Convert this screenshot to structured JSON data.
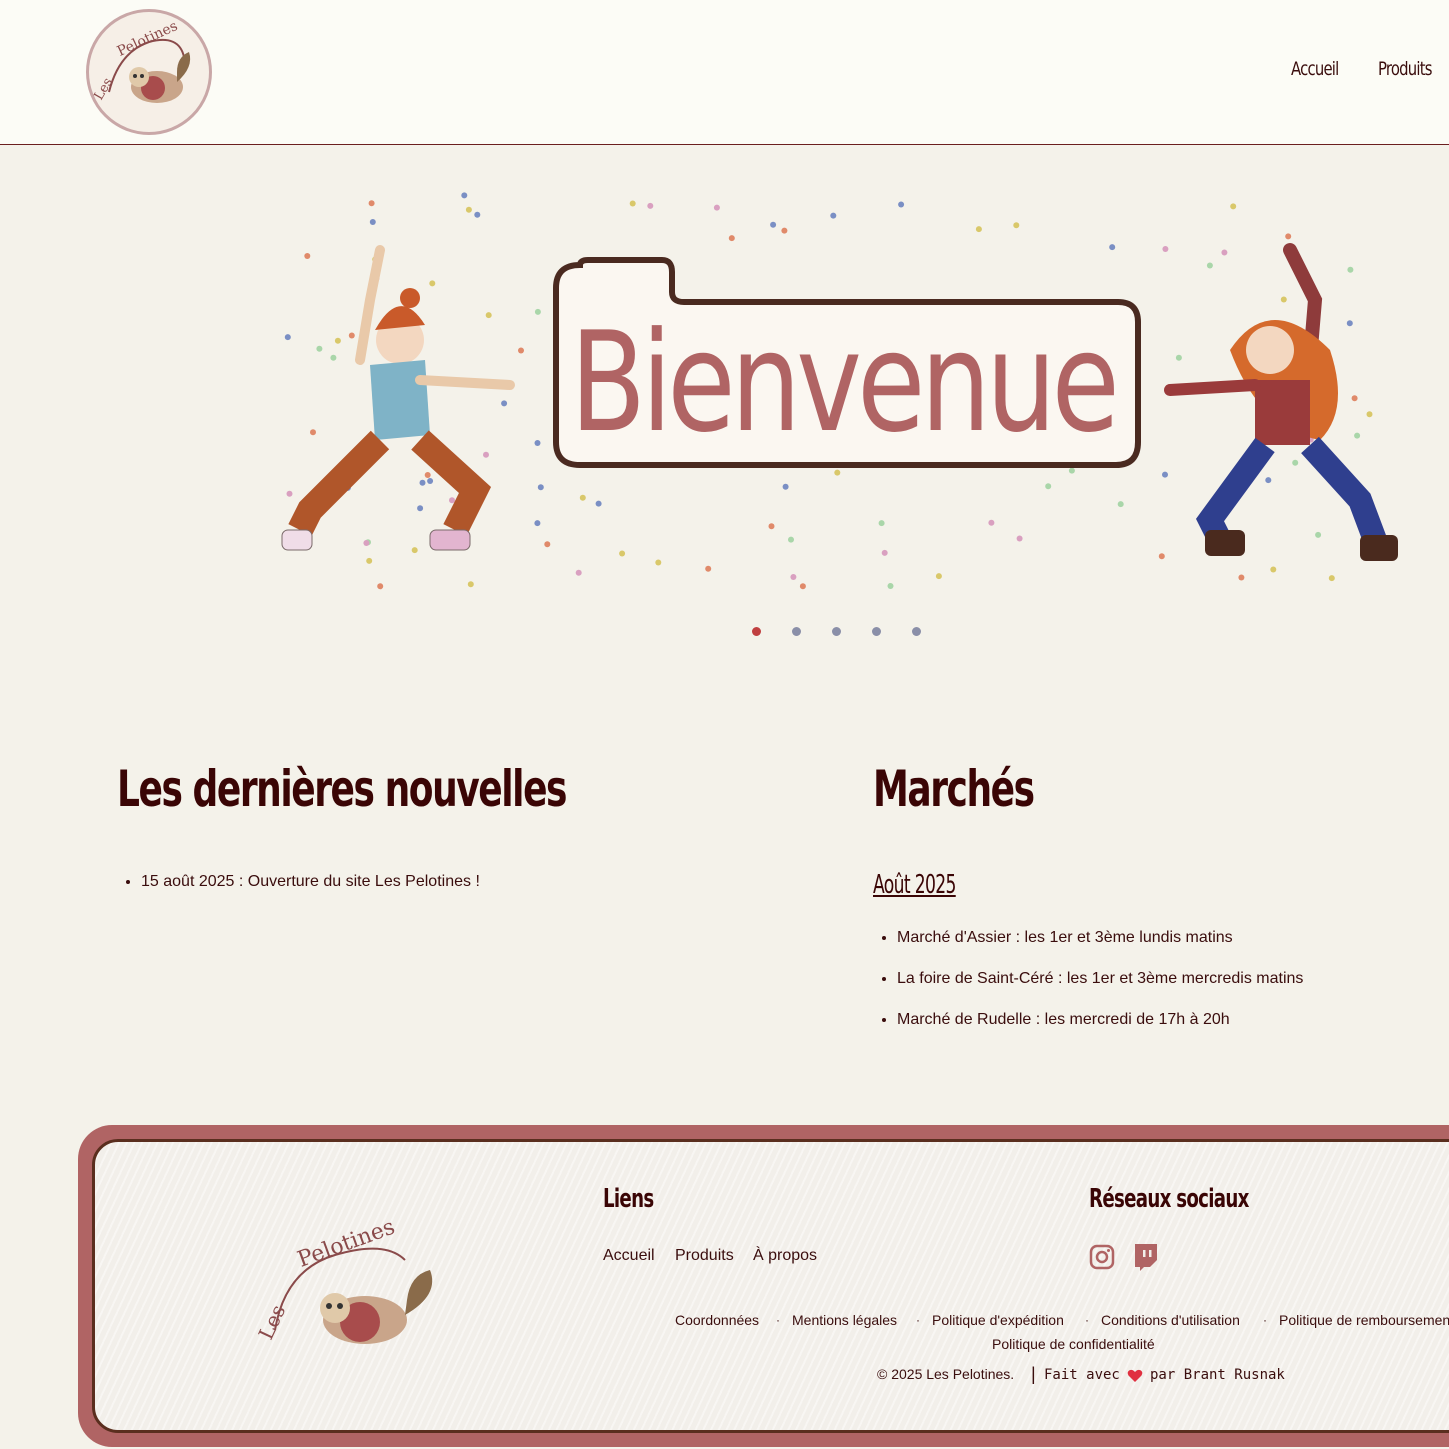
{
  "header": {
    "logo_alt": "Les Pelotines",
    "nav": [
      {
        "label": "Accueil"
      },
      {
        "label": "Produits"
      }
    ]
  },
  "hero": {
    "banner_text": "Bienvenue",
    "carousel_count": 5,
    "carousel_active": 1
  },
  "news": {
    "title": "Les dernières nouvelles",
    "items": [
      "15 août 2025 : Ouverture du site Les Pelotines !"
    ]
  },
  "markets": {
    "title": "Marchés",
    "month": "Août 2025",
    "items": [
      "Marché d'Assier : les 1er et 3ème lundis matins",
      "La foire de Saint-Céré : les 1er et 3ème mercredis matins",
      "Marché de Rudelle : les mercredi de 17h à 20h"
    ]
  },
  "footer": {
    "logo_text": "Les Pelotines",
    "links_title": "Liens",
    "links": [
      "Accueil",
      "Produits",
      "À propos"
    ],
    "social_title": "Réseaux sociaux",
    "social_icons": [
      "instagram-icon",
      "twitch-icon"
    ],
    "legal": [
      "Coordonnées",
      "Mentions légales",
      "Politique d'expédition",
      "Conditions d'utilisation",
      "Politique de remboursement",
      "Politique de confidentialité"
    ],
    "separator": "·",
    "copyright": "© 2025 Les Pelotines.",
    "divider": "|",
    "made_with": "Fait avec",
    "by": "par Brant Rusnak"
  },
  "colors": {
    "accent": "#b06464",
    "dark": "#3a0505",
    "active_dot": "#c04040"
  }
}
